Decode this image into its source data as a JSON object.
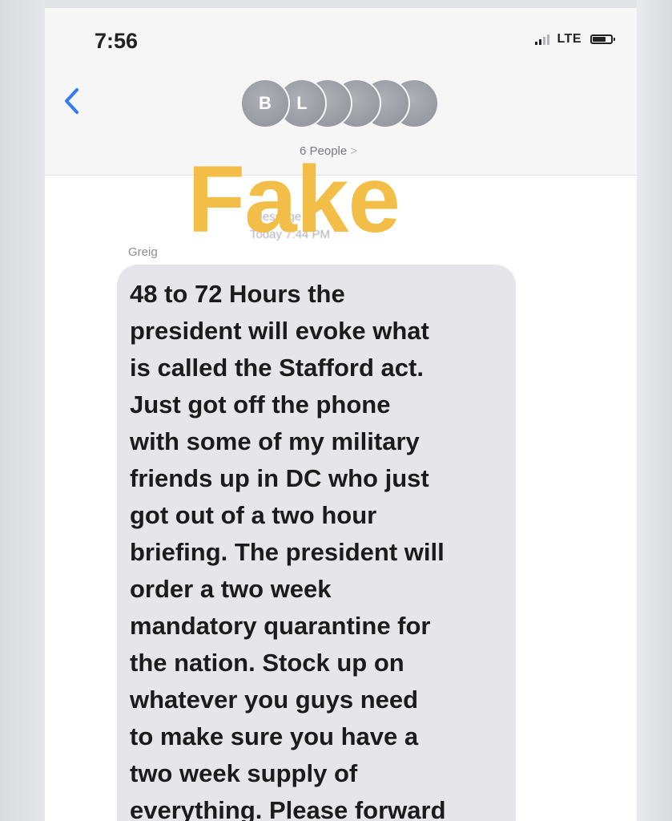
{
  "status_bar": {
    "time": "7:56",
    "network": "LTE",
    "icons": [
      "signal-icon",
      "battery-icon"
    ]
  },
  "header": {
    "back_icon": "chevron-left-icon",
    "avatars": [
      "B",
      "L",
      "",
      "",
      "",
      ""
    ],
    "people_label": "6 People",
    "people_chevron": ">"
  },
  "overlay": {
    "label": "Fake",
    "color": "#f3be48"
  },
  "conversation": {
    "obscured_lines": [
      "iMessage",
      "Today 7:44 PM"
    ],
    "sender": "Greig",
    "message_lines": [
      "48 to 72 Hours the",
      "president will evoke what",
      "is called the Stafford act.",
      "Just got off the phone",
      "with some of my military",
      "friends up in DC who just",
      "got out of a two hour",
      "briefing. The president will",
      "order a two week",
      "mandatory quarantine for",
      "the nation. Stock up on",
      "whatever you guys need",
      "to make sure you have a",
      "two week supply of",
      "everything. Please forward"
    ]
  },
  "colors": {
    "accent_blue": "#2f7cf6",
    "bubble_gray": "#e6e6ea",
    "header_bg": "#f6f6f7"
  }
}
